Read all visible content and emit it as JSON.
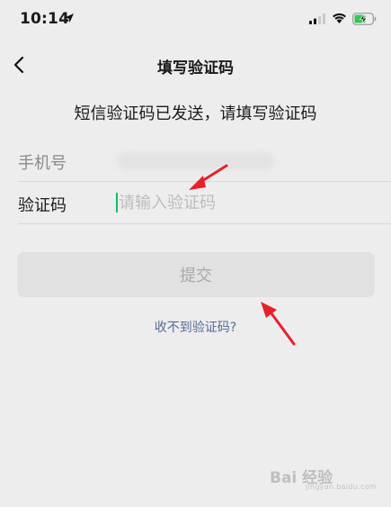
{
  "status_bar": {
    "time": "10:14",
    "icons": [
      "location-arrow-icon",
      "cellular-signal-icon",
      "wifi-icon",
      "battery-charging-icon"
    ]
  },
  "nav": {
    "back_icon": "chevron-left-icon",
    "title": "填写验证码"
  },
  "subtitle": "短信验证码已发送，请填写验证码",
  "form": {
    "phone_label": "手机号",
    "phone_value_blurred": true,
    "code_label": "验证码",
    "code_placeholder": "请输入验证码",
    "code_value": ""
  },
  "submit_label": "提交",
  "help_link": "收不到验证码?",
  "annotations": {
    "arrow_color": "#e8202a",
    "arrows": [
      "arrow-to-code-input",
      "arrow-to-submit-button"
    ]
  },
  "watermark": {
    "brand": "Bai 经验",
    "url": "jingyan.baidu.com"
  },
  "colors": {
    "background": "#ededed",
    "caret": "#07c160",
    "link": "#576b95",
    "button_disabled_bg": "#e1e1e1",
    "button_disabled_text": "#a9a9a9"
  }
}
